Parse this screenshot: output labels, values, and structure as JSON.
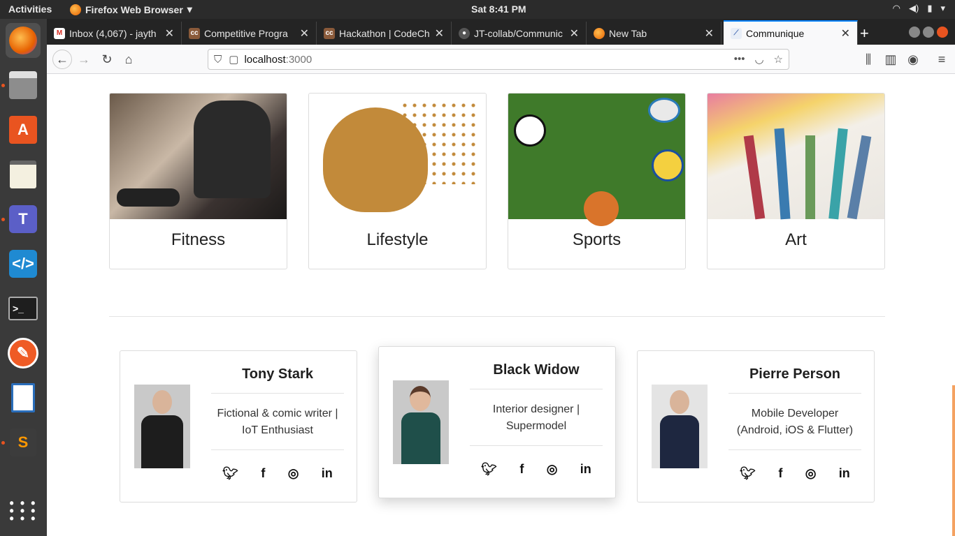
{
  "os": {
    "activities": "Activities",
    "app_name": "Firefox Web Browser",
    "clock": "Sat  8:41 PM"
  },
  "browser": {
    "tabs": [
      {
        "label": "Inbox (4,067) - jayth",
        "favicon": "gmail-icon"
      },
      {
        "label": "Competitive Progra",
        "favicon": "codechef-icon"
      },
      {
        "label": "Hackathon | CodeCh",
        "favicon": "codechef-icon"
      },
      {
        "label": "JT-collab/Communic",
        "favicon": "github-icon"
      },
      {
        "label": "New Tab",
        "favicon": "firefox-icon"
      },
      {
        "label": "Communique",
        "favicon": "page-icon",
        "active": true
      }
    ],
    "url_host": "localhost",
    "url_port": ":3000"
  },
  "categories": [
    {
      "title": "Fitness"
    },
    {
      "title": "Lifestyle"
    },
    {
      "title": "Sports"
    },
    {
      "title": "Art"
    }
  ],
  "team": [
    {
      "name": "Tony Stark",
      "desc": "Fictional & comic writer | IoT Enthusiast"
    },
    {
      "name": "Black Widow",
      "desc": "Interior designer | Supermodel"
    },
    {
      "name": "Pierre Person",
      "desc": "Mobile Developer (Android, iOS & Flutter)"
    }
  ],
  "social_icons": [
    "twitter-icon",
    "facebook-icon",
    "instagram-icon",
    "linkedin-icon"
  ],
  "colors": {
    "accent": "#e95420",
    "tab_active_border": "#0a84ff",
    "scrollbar": "#f4a261"
  }
}
